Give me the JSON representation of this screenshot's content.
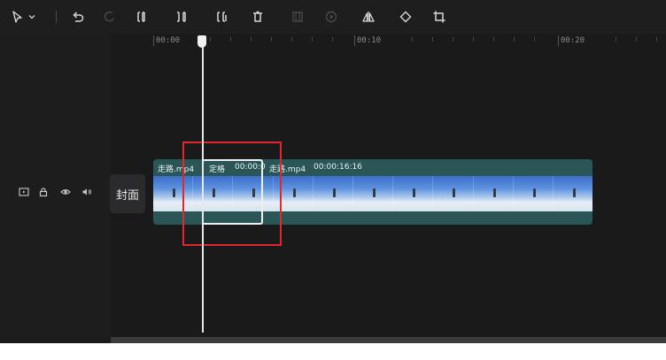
{
  "toolbar": {
    "icons": [
      "select-arrow-icon",
      "chevron-down-icon",
      "undo-icon",
      "redo-icon",
      "split-icon",
      "split-left-icon",
      "split-right-icon",
      "delete-icon",
      "freeze-frame-icon",
      "record-icon",
      "mirror-icon",
      "rotate-icon",
      "crop-icon"
    ]
  },
  "ruler": {
    "labels": [
      "00:00",
      "00:10",
      "00:20"
    ]
  },
  "track": {
    "cover_label": "封面",
    "controls": [
      "video-track-icon",
      "lock-icon",
      "eye-icon",
      "audio-icon"
    ]
  },
  "clip": {
    "label_1": "走路.mp4",
    "label_2": "定格",
    "label_3": "00:00:0",
    "label_4": "走路.mp4",
    "label_5": "00:00:16:16"
  },
  "colors": {
    "accent_teal": "#2a5658",
    "highlight_red": "#e4262f",
    "background": "#1a1a1b"
  }
}
